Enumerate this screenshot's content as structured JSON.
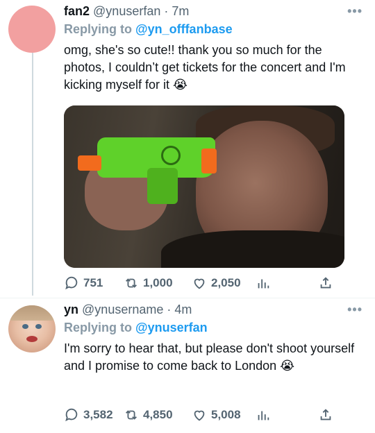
{
  "tweets": [
    {
      "name": "fan2",
      "handle": "@ynuserfan",
      "dot": "·",
      "time": "7m",
      "more": "•••",
      "replying_prefix": "Replying to",
      "replying_to": "@yn_offfanbase",
      "text": "omg, she's so cute!! thank you so much for the photos, I couldn’t get tickets for the concert and I'm kicking myself for it 😭",
      "replies": "751",
      "retweets": "1,000",
      "likes": "2,050"
    },
    {
      "name": "yn",
      "handle": "@ynusername",
      "dot": "·",
      "time": "4m",
      "more": "•••",
      "replying_prefix": "Replying to",
      "replying_to": "@ynuserfan",
      "text": "I'm sorry to hear that, but please don't shoot yourself and I promise to come back to London 😭",
      "replies": "3,582",
      "retweets": "4,850",
      "likes": "5,008"
    }
  ],
  "colors": {
    "accent": "#1d9bf0",
    "secondary": "#536471",
    "avatar_fan2": "#f2a0a0"
  }
}
